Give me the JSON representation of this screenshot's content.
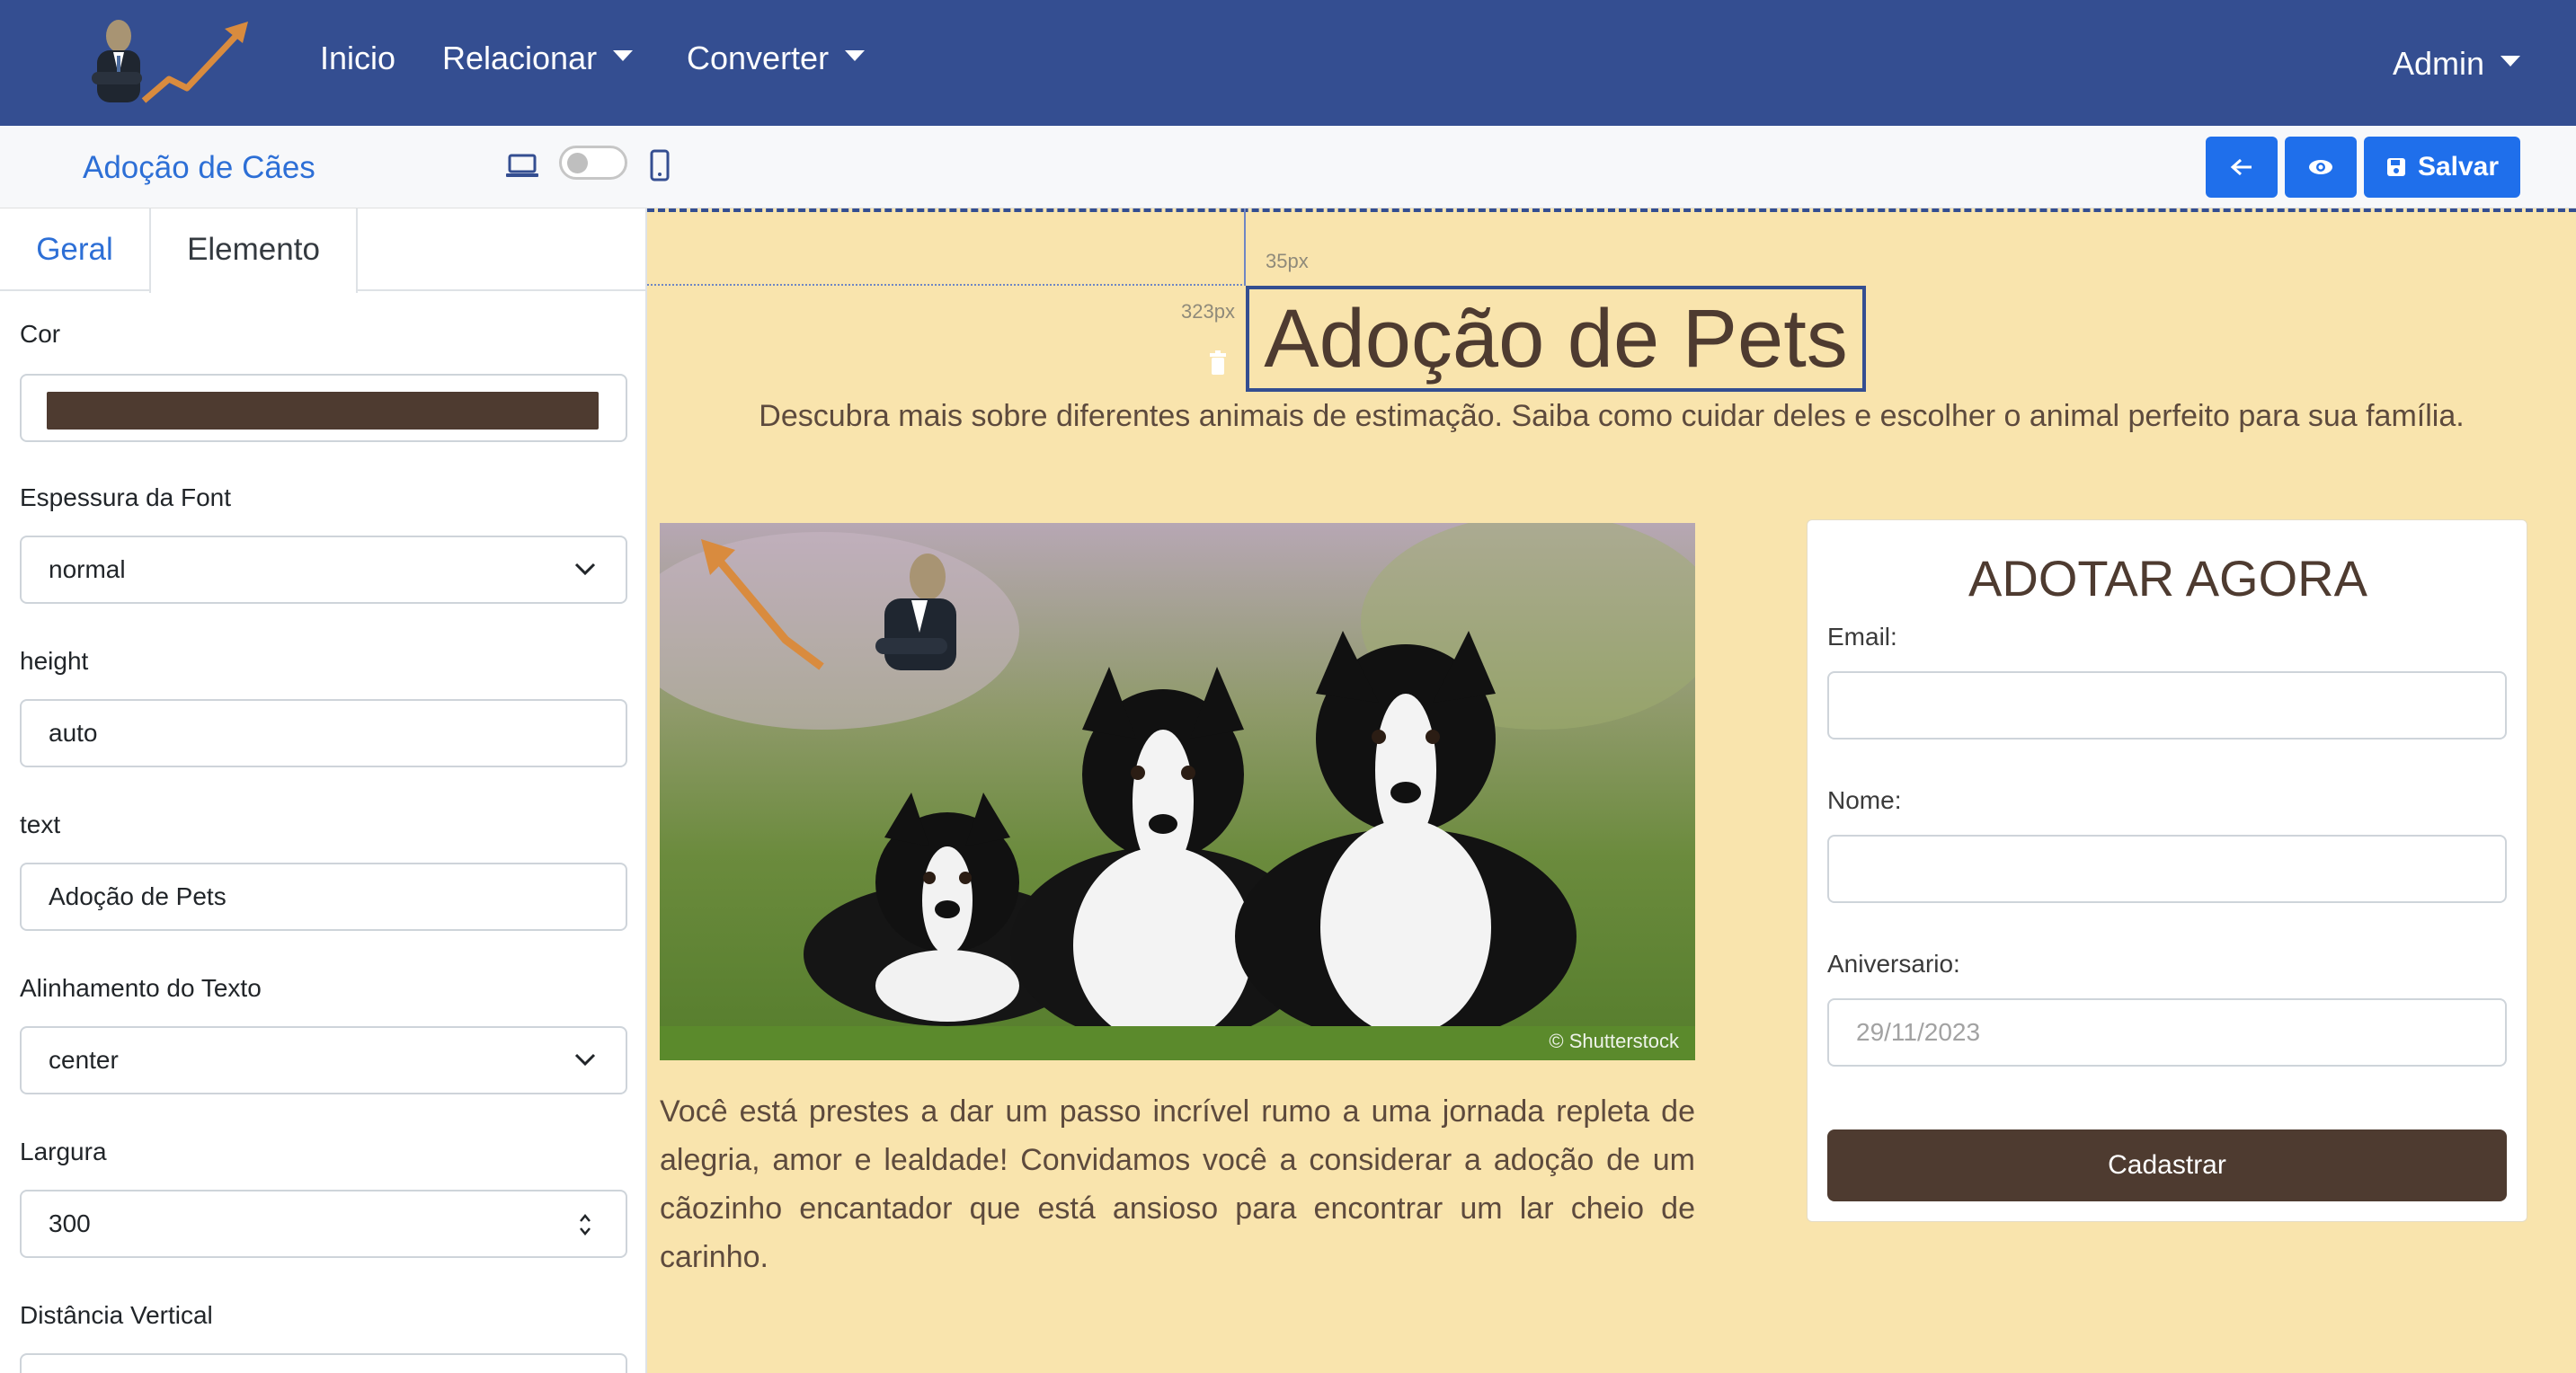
{
  "navbar": {
    "links": [
      {
        "label": "Inicio"
      },
      {
        "label": "Relacionar"
      },
      {
        "label": "Converter"
      }
    ],
    "user_menu": "Admin"
  },
  "toolbar": {
    "title": "Adoção de Cães",
    "save_label": "Salvar"
  },
  "sidebar": {
    "tabs": [
      "Geral",
      "Elemento"
    ],
    "active_tab": "Elemento",
    "fields": {
      "color": {
        "label": "Cor",
        "value": "#4e3b30"
      },
      "font_weight": {
        "label": "Espessura da Font",
        "value": "normal"
      },
      "height": {
        "label": "height",
        "value": "auto"
      },
      "text": {
        "label": "text",
        "value": "Adoção de Pets"
      },
      "text_align": {
        "label": "Alinhamento do Texto",
        "value": "center"
      },
      "width": {
        "label": "Largura",
        "value": "300"
      },
      "vertical_distance": {
        "label": "Distância Vertical"
      }
    }
  },
  "canvas": {
    "guides": {
      "top_label": "35px",
      "left_label": "323px"
    },
    "heading": "Adoção de Pets",
    "subtitle": "Descubra mais sobre diferentes animais de estimação. Saiba como cuidar deles e escolher o animal perfeito para sua família.",
    "image_credit": "© Shutterstock",
    "paragraph": "Você está prestes a dar um passo incrível rumo a uma jornada repleta de alegria, amor e lealdade! Convidamos você a considerar a adoção de um cãozinho encantador que está ansioso para encontrar um lar cheio de carinho.",
    "form": {
      "title": "ADOTAR AGORA",
      "email_label": "Email:",
      "name_label": "Nome:",
      "birthday_label": "Aniversario:",
      "birthday_value": "29/11/2023",
      "submit_label": "Cadastrar"
    }
  },
  "colors": {
    "navbar": "#344e91",
    "accent": "#1f6feb",
    "brown": "#4e3b30",
    "canvas_bg": "#f9e4ad"
  }
}
